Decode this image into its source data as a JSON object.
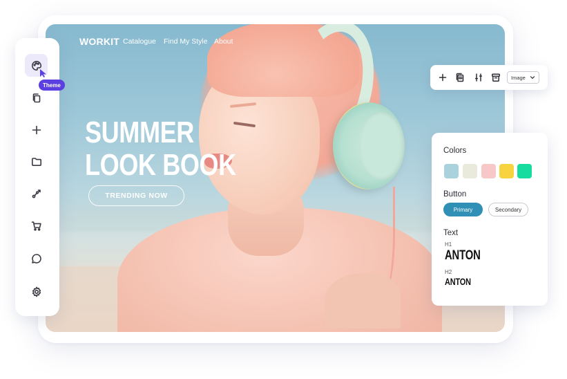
{
  "hero": {
    "brand": "WORKIT",
    "nav": [
      "Catalogue",
      "Find My Style",
      "About"
    ],
    "headline_line1": "SUMMER",
    "headline_line2": "LOOK BOOK",
    "cta": "TRENDING NOW"
  },
  "toolbar": {
    "tools": [
      {
        "name": "theme",
        "icon": "palette-icon",
        "active": true
      },
      {
        "name": "pages",
        "icon": "copy-icon"
      },
      {
        "name": "add",
        "icon": "plus-icon"
      },
      {
        "name": "folder",
        "icon": "folder-icon"
      },
      {
        "name": "flow",
        "icon": "flow-icon"
      },
      {
        "name": "store",
        "icon": "cart-icon"
      },
      {
        "name": "chat",
        "icon": "chat-bubble-icon"
      },
      {
        "name": "settings",
        "icon": "gear-icon"
      }
    ],
    "tooltip": "Theme"
  },
  "image_toolbar": {
    "icons": [
      "plus-icon",
      "duplicate-icon",
      "sliders-icon",
      "archive-icon"
    ],
    "select_value": "Image"
  },
  "style_panel": {
    "colors_label": "Colors",
    "swatches": [
      "#a9d2dc",
      "#e9eadb",
      "#f8c8c8",
      "#f7d43f",
      "#16dca0"
    ],
    "button_label": "Button",
    "primary_label": "Primary",
    "secondary_label": "Secondary",
    "text_label": "Text",
    "h1_tag": "H1",
    "h1_font": "ANTON",
    "h2_tag": "H2",
    "h2_font": "ANTON"
  },
  "colors": {
    "accent": "#5b3fe0",
    "primary_button": "#2f8fb4"
  }
}
